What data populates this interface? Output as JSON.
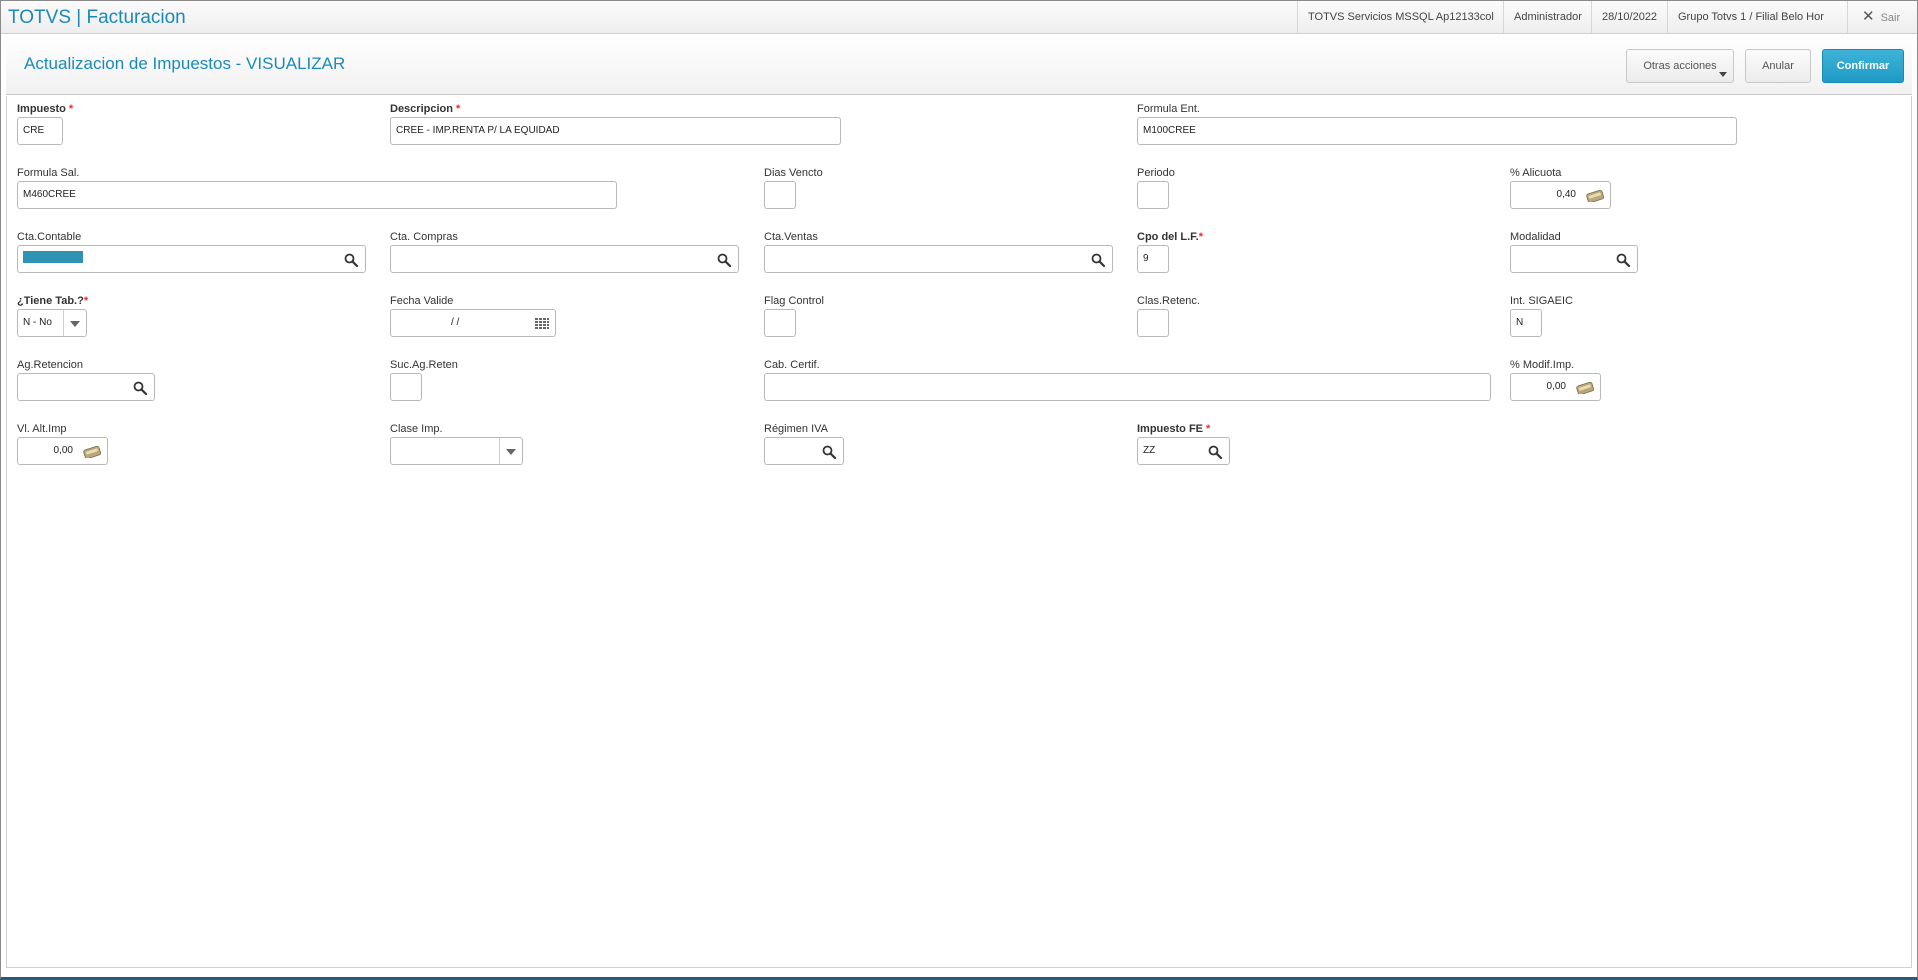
{
  "app": {
    "title": "TOTVS | Facturacion"
  },
  "topbar": {
    "environment": "TOTVS Servicios MSSQL Ap12133col",
    "user": "Administrador",
    "date": "28/10/2022",
    "branch": "Grupo Totvs 1 / Filial Belo Hor",
    "exit_label": "Sair"
  },
  "header": {
    "title": "Actualizacion de Impuestos - VISUALIZAR",
    "other_actions": "Otras acciones",
    "cancel": "Anular",
    "confirm": "Confirmar"
  },
  "form": {
    "impuesto": {
      "label": "Impuesto",
      "value": "CRE"
    },
    "descripcion": {
      "label": "Descripcion",
      "value": "CREE - IMP.RENTA P/ LA EQUIDAD"
    },
    "formula_ent": {
      "label": "Formula Ent.",
      "value": "M100CREE"
    },
    "formula_sal": {
      "label": "Formula Sal.",
      "value": "M460CREE"
    },
    "dias_vencto": {
      "label": "Dias Vencto",
      "value": ""
    },
    "periodo": {
      "label": "Periodo",
      "value": ""
    },
    "alicuota": {
      "label": "% Alicuota",
      "value": "0,40"
    },
    "cta_contable": {
      "label": "Cta.Contable",
      "value": ""
    },
    "cta_compras": {
      "label": "Cta. Compras",
      "value": ""
    },
    "cta_ventas": {
      "label": "Cta.Ventas",
      "value": ""
    },
    "cpo_lf": {
      "label": "Cpo del L.F.",
      "value": "9"
    },
    "modalidad": {
      "label": "Modalidad",
      "value": ""
    },
    "tiene_tab": {
      "label": "¿Tiene Tab.?",
      "value": "N - No"
    },
    "fecha_valide": {
      "label": "Fecha Valide",
      "value": "/  /"
    },
    "flag_control": {
      "label": "Flag Control",
      "value": ""
    },
    "clas_retenc": {
      "label": "Clas.Retenc.",
      "value": ""
    },
    "int_sigaeic": {
      "label": "Int. SIGAEIC",
      "value": "N"
    },
    "ag_retencion": {
      "label": "Ag.Retencion",
      "value": ""
    },
    "suc_ag_reten": {
      "label": "Suc.Ag.Reten",
      "value": ""
    },
    "cab_certif": {
      "label": "Cab. Certif.",
      "value": ""
    },
    "modif_imp": {
      "label": "% Modif.Imp.",
      "value": "0,00"
    },
    "vl_alt_imp": {
      "label": "Vl. Alt.Imp",
      "value": "0,00"
    },
    "clase_imp": {
      "label": "Clase Imp.",
      "value": ""
    },
    "regimen_iva": {
      "label": "Régimen IVA",
      "value": ""
    },
    "impuesto_fe": {
      "label": "Impuesto FE",
      "value": "ZZ"
    }
  }
}
